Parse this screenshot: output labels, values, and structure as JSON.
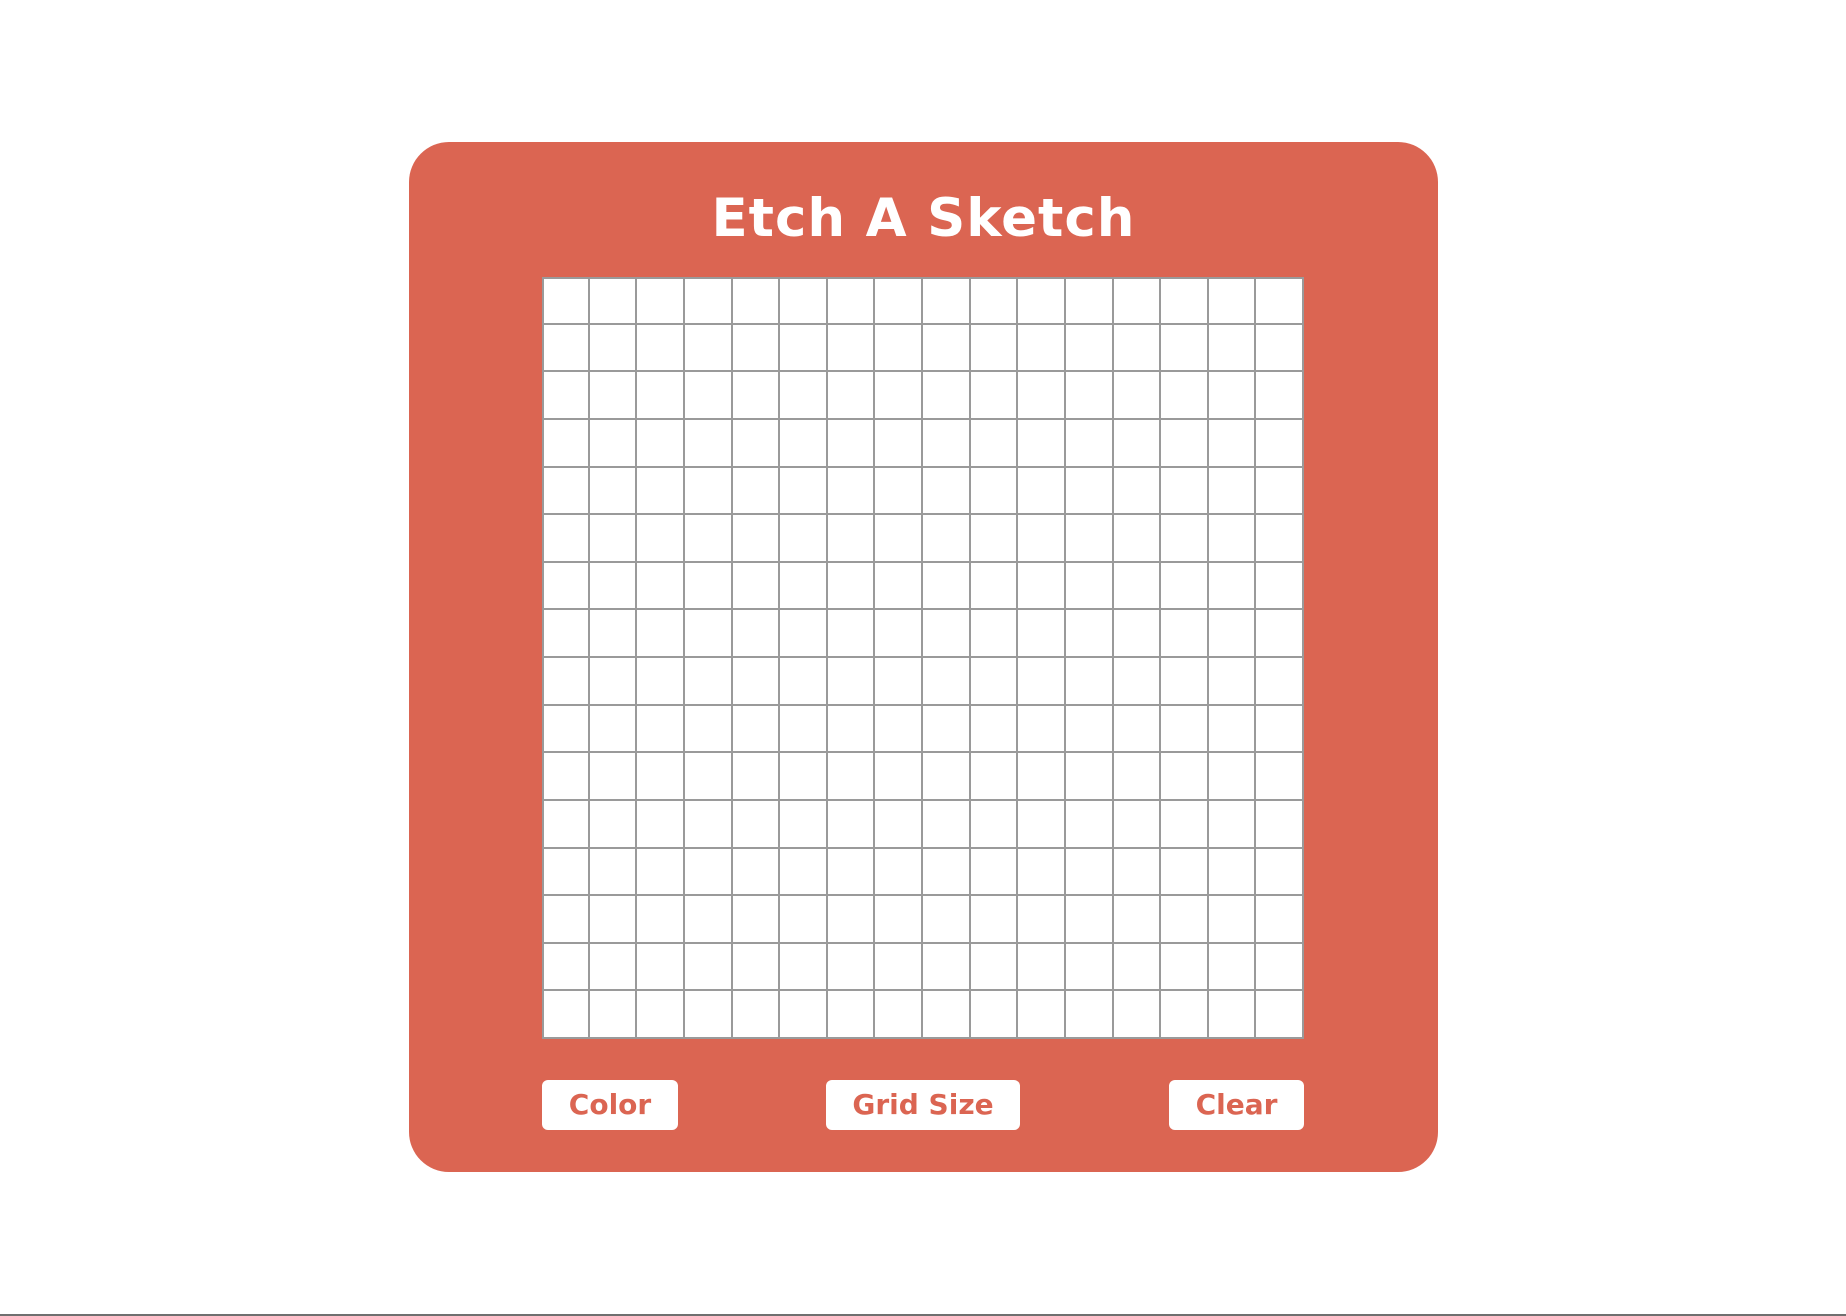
{
  "app": {
    "title": "Etch A Sketch"
  },
  "grid": {
    "rows": 16,
    "columns": 16,
    "cell_color": "#ffffff",
    "line_color": "#9a9a9a"
  },
  "controls": {
    "color_label": "Color",
    "grid_size_label": "Grid Size",
    "clear_label": "Clear"
  },
  "colors": {
    "accent": "#db6552",
    "background": "#ffffff",
    "text_on_accent": "#ffffff"
  }
}
